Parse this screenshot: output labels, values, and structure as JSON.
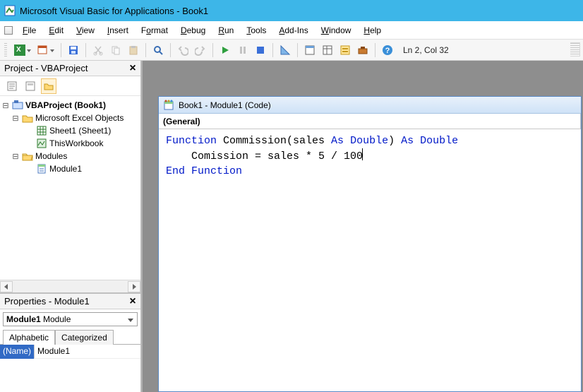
{
  "title": "Microsoft Visual Basic for Applications - Book1",
  "menu": {
    "file": "File",
    "edit": "Edit",
    "view": "View",
    "insert": "Insert",
    "format": "Format",
    "debug": "Debug",
    "run": "Run",
    "tools": "Tools",
    "addins": "Add-Ins",
    "window": "Window",
    "help": "Help"
  },
  "toolbar": {
    "cursor_status": "Ln 2, Col 32"
  },
  "project": {
    "header": "Project - VBAProject",
    "root": "VBAProject (Book1)",
    "excel_objects": "Microsoft Excel Objects",
    "sheet1": "Sheet1 (Sheet1)",
    "thiswb": "ThisWorkbook",
    "modules": "Modules",
    "module1": "Module1"
  },
  "properties": {
    "header": "Properties - Module1",
    "combo_name": "Module1",
    "combo_type": "Module",
    "tab_alpha": "Alphabetic",
    "tab_cat": "Categorized",
    "name_key": "(Name)",
    "name_val": "Module1"
  },
  "codewin": {
    "title": "Book1 - Module1 (Code)",
    "left_combo": "(General)",
    "line1a": "Function",
    "line1b": " Commission(sales ",
    "line1c": "As",
    "line1d": " ",
    "line1e": "Double",
    "line1f": ") ",
    "line1g": "As",
    "line1h": " ",
    "line1i": "Double",
    "line2": "    Comission = sales * 5 / 100",
    "line3a": "End",
    "line3b": " ",
    "line3c": "Function"
  }
}
